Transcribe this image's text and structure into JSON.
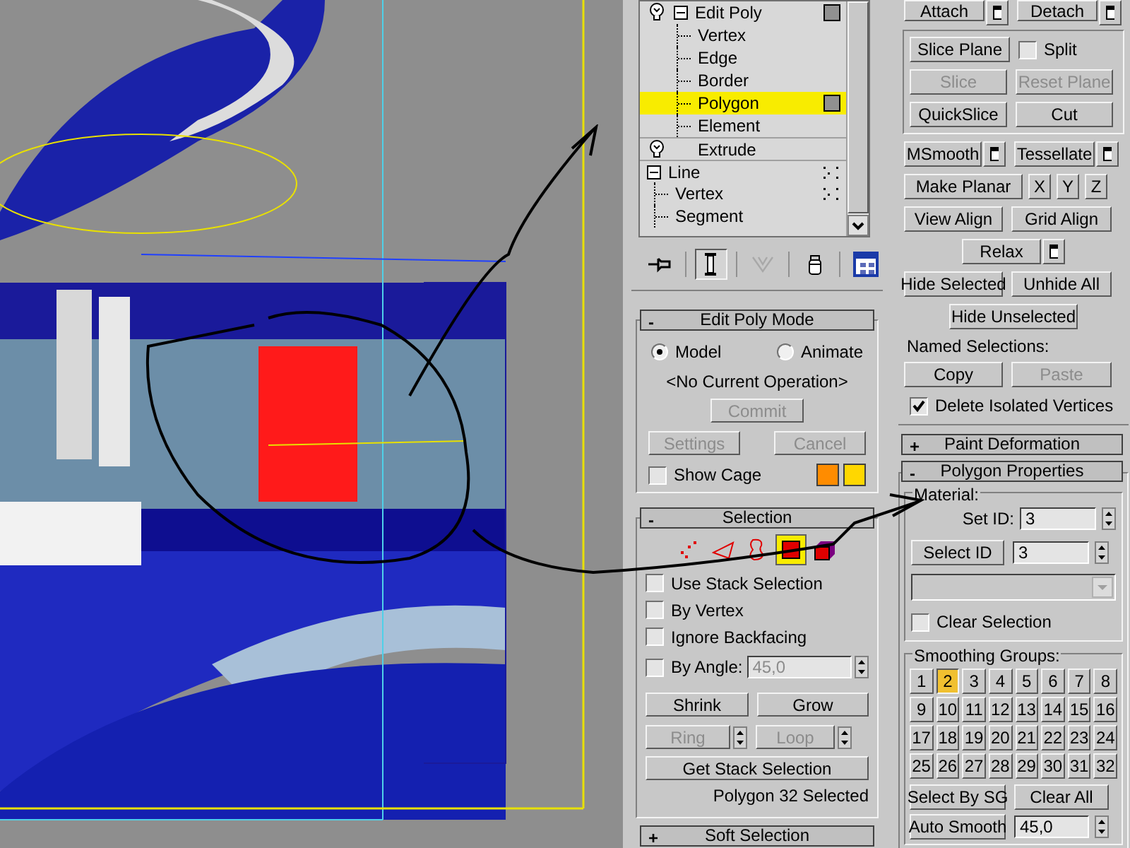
{
  "stack": {
    "items": [
      {
        "label": "Edit Poly",
        "kind": "modifier",
        "expanded": true,
        "children": [
          {
            "label": "Vertex",
            "selected": false
          },
          {
            "label": "Edge",
            "selected": false
          },
          {
            "label": "Border",
            "selected": false
          },
          {
            "label": "Polygon",
            "selected": true
          },
          {
            "label": "Element",
            "selected": false
          }
        ]
      },
      {
        "label": "Extrude",
        "kind": "modifier"
      },
      {
        "label": "Line",
        "kind": "object",
        "expanded": true,
        "children": [
          {
            "label": "Vertex",
            "selected": false
          },
          {
            "label": "Segment",
            "selected": false
          }
        ]
      }
    ]
  },
  "stack_toolbar": [
    {
      "kind": "pin",
      "selected": false
    },
    {
      "kind": "end_result",
      "selected": true
    },
    {
      "kind": "unique",
      "selected": false
    },
    {
      "kind": "remove",
      "selected": false
    },
    {
      "kind": "configure",
      "selected": false
    }
  ],
  "edit_poly_mode": {
    "sign": "-",
    "title": "Edit Poly Mode",
    "modes": [
      {
        "label": "Model",
        "selected": true
      },
      {
        "label": "Animate",
        "selected": false
      }
    ],
    "operation": "<No Current Operation>",
    "commit": {
      "label": "Commit",
      "disabled": true
    },
    "settings": {
      "label": "Settings",
      "disabled": true
    },
    "cancel": {
      "label": "Cancel",
      "disabled": true
    },
    "show_cage": {
      "label": "Show Cage",
      "checked": false
    },
    "cage_colors": [
      {
        "color": "#ff8c00"
      },
      {
        "color": "#ffd700"
      }
    ]
  },
  "selection": {
    "sign": "-",
    "title": "Selection",
    "levels": [
      {
        "kind": "vertex",
        "selected": false
      },
      {
        "kind": "edge",
        "selected": false
      },
      {
        "kind": "border",
        "selected": false
      },
      {
        "kind": "polygon",
        "selected": true
      },
      {
        "kind": "element",
        "selected": false
      }
    ],
    "options": [
      {
        "label": "Use Stack Selection",
        "checked": false
      },
      {
        "label": "By Vertex",
        "checked": false
      },
      {
        "label": "Ignore Backfacing",
        "checked": false
      }
    ],
    "by_angle": {
      "label": "By Angle:",
      "checked": false,
      "value": "45,0"
    },
    "shrink": {
      "label": "Shrink",
      "disabled": false
    },
    "grow": {
      "label": "Grow",
      "disabled": false
    },
    "ring": {
      "label": "Ring",
      "disabled": true
    },
    "loop": {
      "label": "Loop",
      "disabled": true
    },
    "get_stack": {
      "label": "Get Stack Selection",
      "disabled": false
    },
    "status": "Polygon 32 Selected"
  },
  "soft_selection": {
    "sign": "+",
    "title": "Soft Selection"
  },
  "edit_geometry": {
    "attach": {
      "label": "Attach",
      "disabled": false
    },
    "detach": {
      "label": "Detach",
      "disabled": false
    },
    "slice_plane": {
      "label": "Slice Plane",
      "disabled": false
    },
    "split": {
      "label": "Split",
      "checked": false
    },
    "slice": {
      "label": "Slice",
      "disabled": true
    },
    "reset_plane": {
      "label": "Reset Plane",
      "disabled": true
    },
    "quickslice": {
      "label": "QuickSlice",
      "disabled": false
    },
    "cut": {
      "label": "Cut",
      "disabled": false
    },
    "msmooth": {
      "label": "MSmooth",
      "disabled": false
    },
    "tessellate": {
      "label": "Tessellate",
      "disabled": false
    },
    "make_planar": {
      "label": "Make Planar",
      "disabled": false
    },
    "axes": [
      {
        "label": "X",
        "disabled": false
      },
      {
        "label": "Y",
        "disabled": false
      },
      {
        "label": "Z",
        "disabled": false
      }
    ],
    "view_align": {
      "label": "View Align",
      "disabled": false
    },
    "grid_align": {
      "label": "Grid Align",
      "disabled": false
    },
    "relax": {
      "label": "Relax",
      "disabled": false
    },
    "hide_selected": {
      "label": "Hide Selected",
      "disabled": false
    },
    "unhide_all": {
      "label": "Unhide All",
      "disabled": false
    },
    "hide_unselected": {
      "label": "Hide Unselected",
      "disabled": false
    },
    "named_selections": "Named Selections:",
    "copy": {
      "label": "Copy",
      "disabled": false
    },
    "paste": {
      "label": "Paste",
      "disabled": true
    },
    "delete_isolated": {
      "label": "Delete Isolated Vertices",
      "checked": true
    }
  },
  "paint_deformation": {
    "sign": "+",
    "title": "Paint Deformation"
  },
  "polygon_properties": {
    "sign": "-",
    "title": "Polygon Properties",
    "material_label": "Material:",
    "set_id": {
      "label": "Set ID:",
      "value": "3"
    },
    "select_id": {
      "label": "Select ID",
      "disabled": false,
      "value": "3"
    },
    "clear_selection": {
      "label": "Clear Selection",
      "checked": false
    },
    "smoothing_label": "Smoothing Groups:",
    "groups": [
      {
        "label": "1",
        "selected": false
      },
      {
        "label": "2",
        "selected": true
      },
      {
        "label": "3",
        "selected": false
      },
      {
        "label": "4",
        "selected": false
      },
      {
        "label": "5",
        "selected": false
      },
      {
        "label": "6",
        "selected": false
      },
      {
        "label": "7",
        "selected": false
      },
      {
        "label": "8",
        "selected": false
      },
      {
        "label": "9",
        "selected": false
      },
      {
        "label": "10",
        "selected": false
      },
      {
        "label": "11",
        "selected": false
      },
      {
        "label": "12",
        "selected": false
      },
      {
        "label": "13",
        "selected": false
      },
      {
        "label": "14",
        "selected": false
      },
      {
        "label": "15",
        "selected": false
      },
      {
        "label": "16",
        "selected": false
      },
      {
        "label": "17",
        "selected": false
      },
      {
        "label": "18",
        "selected": false
      },
      {
        "label": "19",
        "selected": false
      },
      {
        "label": "20",
        "selected": false
      },
      {
        "label": "21",
        "selected": false
      },
      {
        "label": "22",
        "selected": false
      },
      {
        "label": "23",
        "selected": false
      },
      {
        "label": "24",
        "selected": false
      },
      {
        "label": "25",
        "selected": false
      },
      {
        "label": "26",
        "selected": false
      },
      {
        "label": "27",
        "selected": false
      },
      {
        "label": "28",
        "selected": false
      },
      {
        "label": "29",
        "selected": false
      },
      {
        "label": "30",
        "selected": false
      },
      {
        "label": "31",
        "selected": false
      },
      {
        "label": "32",
        "selected": false
      }
    ],
    "select_by_sg": {
      "label": "Select By SG",
      "disabled": false
    },
    "clear_all": {
      "label": "Clear All",
      "disabled": false
    },
    "auto_smooth": {
      "label": "Auto Smooth",
      "disabled": false,
      "value": "45,0"
    }
  }
}
